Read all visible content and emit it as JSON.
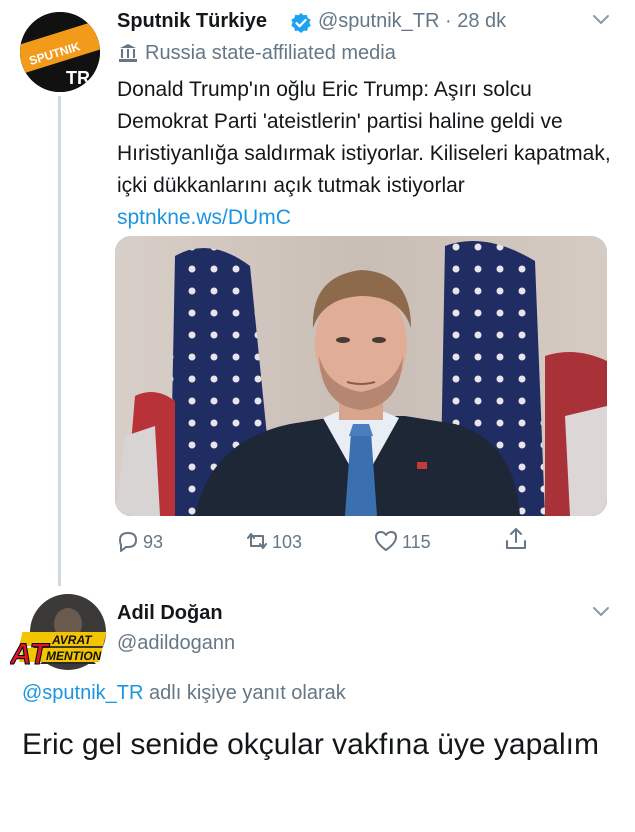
{
  "tweet1": {
    "avatar_text": "SPUTNIK",
    "avatar_sub": "TR",
    "display_name": "Sputnik Türkiye",
    "handle_time": "@sputnik_TR · 28 dk",
    "affiliation": "Russia state-affiliated media",
    "text": "Donald Trump'ın oğlu Eric Trump: Aşırı solcu Demokrat Parti 'ateistlerin' partisi haline geldi ve Hıristiyanlığa saldırmak istiyorlar. Kiliseleri kapatmak, içki dükkanlarını açık tutmak istiyorlar",
    "link": "sptnkne.ws/DUmC",
    "replies": "93",
    "retweets": "103",
    "likes": "115"
  },
  "tweet2": {
    "avatar_text_top": "AVRAT",
    "avatar_text_bottom": "MENTION",
    "avatar_text_big": "AT",
    "display_name": "Adil Doğan",
    "handle": "@adildogann",
    "reply_to_handle": "@sputnik_TR",
    "reply_to_suffix": " adlı kişiye yanıt olarak",
    "text": "Eric gel senide okçular vakfına üye yapalım"
  },
  "colors": {
    "link": "#1b95e0",
    "muted": "#657786",
    "verified": "#1da1f2",
    "sputnik_orange": "#f29a19"
  }
}
